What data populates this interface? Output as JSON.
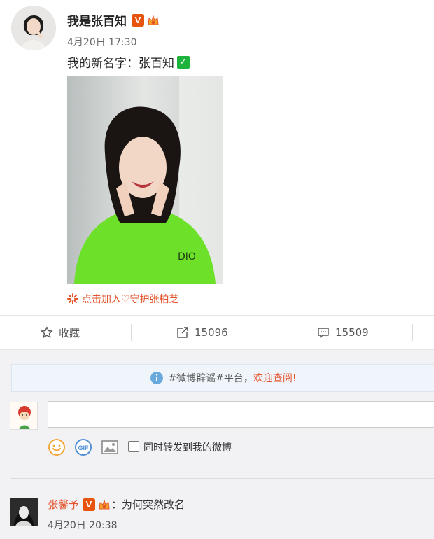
{
  "post": {
    "author": "我是张百知",
    "time": "4月20日 17:30",
    "text": "我的新名字：张百知",
    "check_mark": "✓",
    "verified_badge": "V",
    "guard_link": "点击加入♡守护张柏芝",
    "colors": {
      "accent": "#e4542c",
      "verified": "#e8540e",
      "check": "#1db43e"
    }
  },
  "actions": {
    "favorite_label": "收藏",
    "repost_count": "15096",
    "comment_count": "15509",
    "icons": [
      "star-icon",
      "share-icon",
      "comment-icon"
    ]
  },
  "notice": {
    "text": "#微博辟谣#平台，",
    "link": "欢迎查阅!"
  },
  "composer": {
    "input_value": "",
    "repost_option_label": "同时转发到我的微博",
    "tools": [
      "emoji-icon",
      "gif-icon",
      "image-icon"
    ]
  },
  "comments": [
    {
      "author": "张馨予",
      "separator": "：",
      "text": "为何突然改名",
      "time": "4月20日 20:38",
      "verified_badge": "V"
    }
  ]
}
